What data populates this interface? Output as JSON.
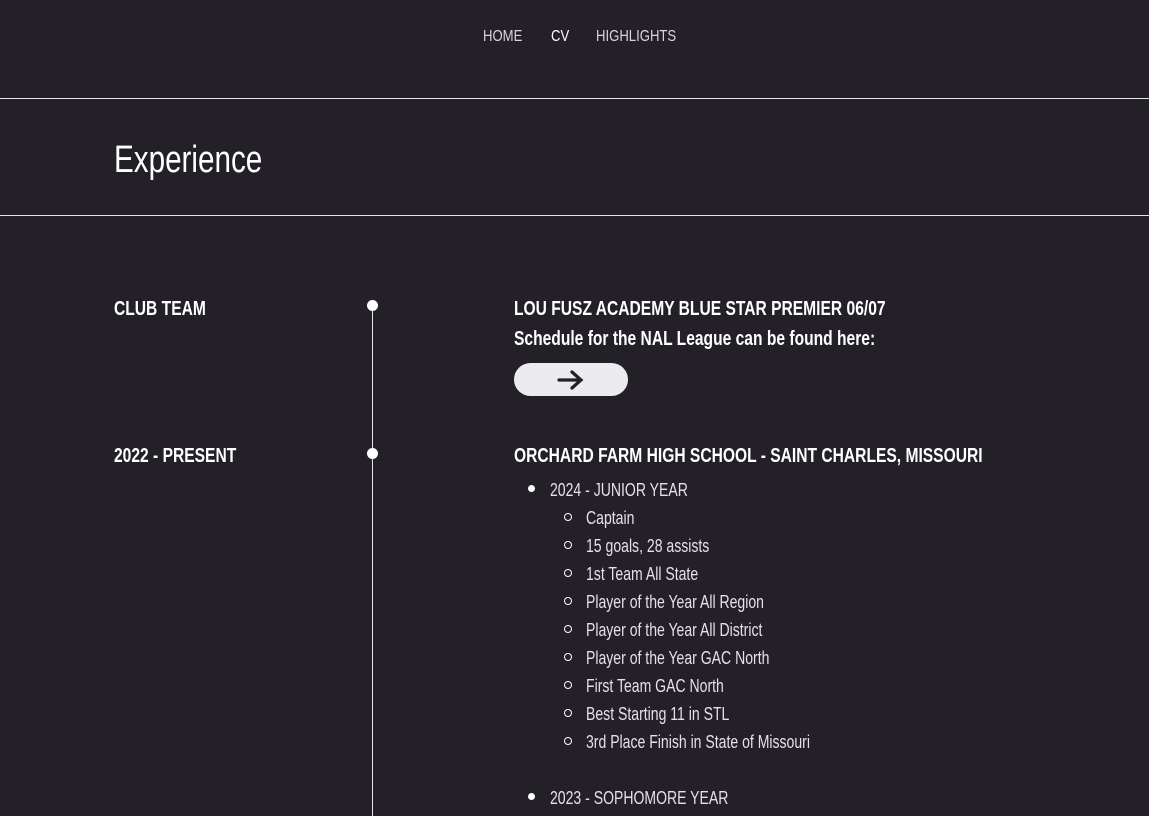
{
  "nav": {
    "home": "HOME",
    "cv": "CV",
    "highlights": "HIGHLIGHTS",
    "active": "CV"
  },
  "header": {
    "title": "Experience"
  },
  "entries": [
    {
      "label": "CLUB TEAM",
      "title": "LOU FUSZ ACADEMY BLUE STAR PREMIER 06/07",
      "subtitle": "Schedule for the NAL League can be found here:",
      "button_icon": "arrow-right-icon"
    },
    {
      "label": "2022 - PRESENT",
      "title": "ORCHARD FARM HIGH SCHOOL -  SAINT CHARLES, MISSOURI",
      "years": [
        {
          "label": "2024 - JUNIOR YEAR",
          "items": [
            "Captain",
            "15 goals, 28 assists",
            "1st Team All State",
            "Player of the Year All Region",
            "Player of the Year All District",
            "Player of the Year GAC North",
            "First Team GAC North",
            "Best Starting 11 in STL",
            "3rd Place Finish in State of Missouri"
          ]
        },
        {
          "label": "2023 - SOPHOMORE YEAR",
          "items": []
        }
      ]
    }
  ],
  "colors": {
    "background": "#232028",
    "text": "#ffffff",
    "divider": "#e6e6e6",
    "button": "#ececee"
  }
}
